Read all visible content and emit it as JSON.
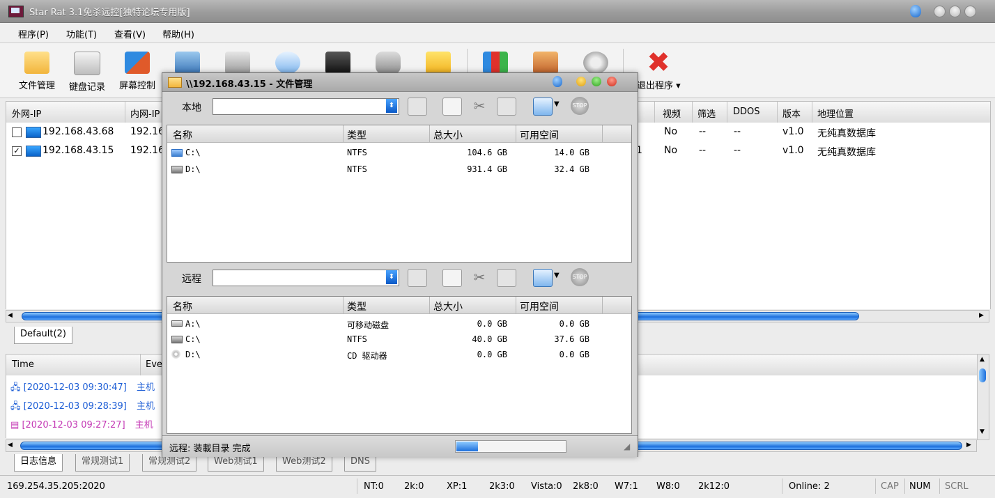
{
  "window": {
    "title": "Star Rat 3.1免杀远控[独特论坛专用版]"
  },
  "menu": [
    "程序(P)",
    "功能(T)",
    "查看(V)",
    "帮助(H)"
  ],
  "toolbar": {
    "file_mgr": "文件管理",
    "keylog": "键盘记录",
    "screen": "屏幕控制",
    "exit": "退出程序"
  },
  "clients": {
    "columns": {
      "wan_ip": "外网-IP",
      "lan_ip": "内网-IP",
      "video": "视频",
      "filter": "筛选",
      "ddos": "DDOS",
      "version": "版本",
      "location": "地理位置"
    },
    "rows": [
      {
        "wan_ip": "192.168.43.68",
        "lan_ip": "192.16",
        "video": "No",
        "filter": "--",
        "ddos": "--",
        "version": "v1.0",
        "location": "无纯真数据库",
        "checked": false,
        "partial": ""
      },
      {
        "wan_ip": "192.168.43.15",
        "lan_ip": "192.16",
        "video": "No",
        "filter": "--",
        "ddos": "--",
        "version": "v1.0",
        "location": "无纯真数据库",
        "checked": true,
        "partial": "1"
      }
    ]
  },
  "group_tabs": [
    "Default(2)"
  ],
  "log": {
    "columns": {
      "time": "Time",
      "event": "Eve"
    },
    "rows": [
      {
        "time": "[2020-12-03 09:30:47]",
        "event": "主机",
        "color": "#1f5fd6"
      },
      {
        "time": "[2020-12-03 09:28:39]",
        "event": "主机",
        "color": "#1f5fd6"
      },
      {
        "time": "[2020-12-03 09:27:27]",
        "event": "主机",
        "color": "#c43ab5"
      }
    ]
  },
  "bottom_tabs": [
    "日志信息",
    "常规测试1",
    "常规测试2",
    "Web测试1",
    "Web测试2",
    "DNS"
  ],
  "status": {
    "address": "169.254.35.205:2020",
    "nt": "NT:0",
    "k2": "2k:0",
    "xp": "XP:1",
    "k23": "2k3:0",
    "vista": "Vista:0",
    "k28": "2k8:0",
    "w7": "W7:1",
    "w8": "W8:0",
    "k212": "2k12:0",
    "online": "Online: 2",
    "cap": "CAP",
    "num": "NUM",
    "scrl": "SCRL"
  },
  "file_manager": {
    "title": "\\\\192.168.43.15 - 文件管理",
    "local_label": "本地",
    "remote_label": "远程",
    "columns": {
      "name": "名称",
      "type": "类型",
      "total": "总大小",
      "free": "可用空间"
    },
    "local_rows": [
      {
        "name": "C:\\",
        "type": "NTFS",
        "total": "104.6 GB",
        "free": "14.0 GB"
      },
      {
        "name": "D:\\",
        "type": "NTFS",
        "total": "931.4 GB",
        "free": "32.4 GB"
      }
    ],
    "remote_rows": [
      {
        "name": "A:\\",
        "type": "可移动磁盘",
        "total": "0.0 GB",
        "free": "0.0 GB"
      },
      {
        "name": "C:\\",
        "type": "NTFS",
        "total": "40.0 GB",
        "free": "37.6 GB"
      },
      {
        "name": "D:\\",
        "type": "CD 驱动器",
        "total": "0.0 GB",
        "free": "0.0 GB"
      }
    ],
    "status_text": "远程: 装載目录  完成",
    "progress": 0.2
  },
  "colors": {
    "accent": "#1d6fdc",
    "close_x": "#e0312b",
    "log_blue": "#1f5fd6",
    "log_purple": "#c43ab5"
  }
}
